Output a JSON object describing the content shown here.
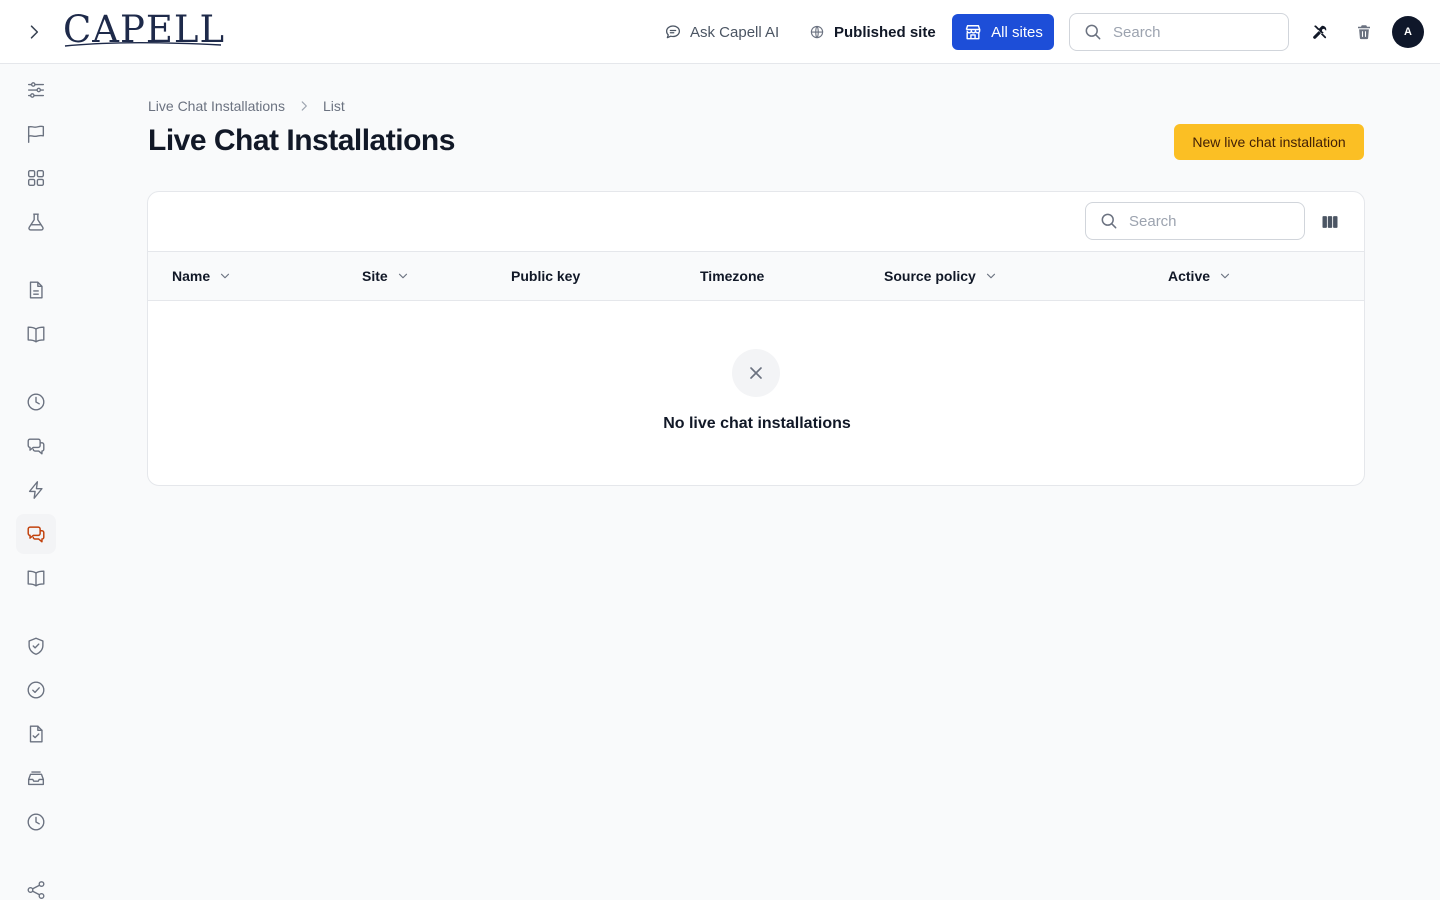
{
  "brand": {
    "logo_text": "CAPELL"
  },
  "header": {
    "ask_ai_label": "Ask Capell AI",
    "published_site_label": "Published site",
    "all_sites_label": "All sites",
    "search_placeholder": "Search",
    "avatar_initial": "A"
  },
  "sidebar": {
    "items": [
      {
        "icon": "sliders-icon",
        "active": false
      },
      {
        "icon": "flag-icon",
        "active": false
      },
      {
        "icon": "grid-icon",
        "active": false
      },
      {
        "icon": "beaker-icon",
        "active": false
      },
      {
        "icon": "document-icon",
        "active": false
      },
      {
        "icon": "book-open-icon",
        "active": false
      },
      {
        "icon": "clock-icon",
        "active": false
      },
      {
        "icon": "chat-bubbles-icon",
        "active": false
      },
      {
        "icon": "bolt-icon",
        "active": false
      },
      {
        "icon": "chat-bubbles-icon",
        "active": true
      },
      {
        "icon": "book-open-icon",
        "active": false
      },
      {
        "icon": "shield-check-icon",
        "active": false
      },
      {
        "icon": "check-circle-icon",
        "active": false
      },
      {
        "icon": "document-check-icon",
        "active": false
      },
      {
        "icon": "inbox-stack-icon",
        "active": false
      },
      {
        "icon": "clock-icon",
        "active": false
      },
      {
        "icon": "share-icon",
        "active": false
      }
    ],
    "accent_color": "#c2410c"
  },
  "breadcrumb": {
    "parent": "Live Chat Installations",
    "current": "List"
  },
  "page": {
    "title": "Live Chat Installations",
    "new_button_label": "New live chat installation"
  },
  "table": {
    "search_placeholder": "Search",
    "columns": [
      {
        "label": "Name",
        "sortable": true
      },
      {
        "label": "Site",
        "sortable": true
      },
      {
        "label": "Public key",
        "sortable": false
      },
      {
        "label": "Timezone",
        "sortable": false
      },
      {
        "label": "Source policy",
        "sortable": true
      },
      {
        "label": "Active",
        "sortable": true
      }
    ],
    "rows": [],
    "empty_text": "No live chat installations"
  },
  "colors": {
    "primary": "#1d4ed8",
    "warning": "#fbbf24",
    "avatar_bg": "#0f172a"
  }
}
